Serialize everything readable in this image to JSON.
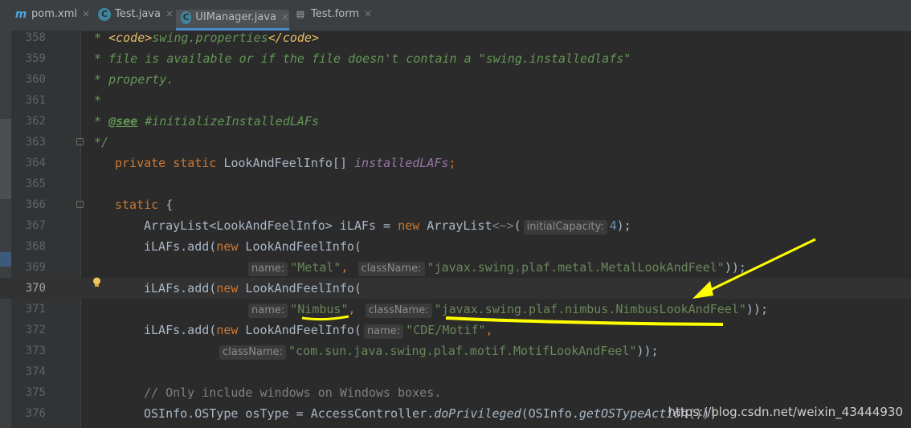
{
  "tabs": [
    {
      "icon_text": "m",
      "label": "pom.xml"
    },
    {
      "icon_text": "C",
      "label": "Test.java"
    },
    {
      "icon_text": "C",
      "label": "UIManager.java"
    },
    {
      "icon_text": "▤",
      "label": "Test.form"
    }
  ],
  "close_glyph": "×",
  "code_lines": {
    "358": {
      "num": "358",
      "star": " * ",
      "tag_open": "<code>",
      "text": "swing.properties",
      "tag_close": "</code>"
    },
    "359": {
      "num": "359",
      "text": " * file is available or if the file doesn't contain a \"swing.installedlafs\""
    },
    "360": {
      "num": "360",
      "text": " * property."
    },
    "361": {
      "num": "361",
      "text": " *"
    },
    "362": {
      "num": "362",
      "star": " * ",
      "ann": "@see",
      "text": " #initializeInstalledLAFs"
    },
    "363": {
      "num": "363",
      "text": " */"
    },
    "364": {
      "num": "364",
      "kw": "private static",
      "type": " LookAndFeelInfo[] ",
      "field": "installedLAFs",
      "end": ";"
    },
    "365": {
      "num": "365"
    },
    "366": {
      "num": "366",
      "kw": "static",
      "text": " {"
    },
    "367": {
      "num": "367",
      "a": "ArrayList<LookAndFeelInfo> iLAFs = ",
      "kw": "new",
      "b": " ArrayList",
      "diamond": "<~>",
      "c": "(",
      "hint": "initialCapacity:",
      "num_val": "4",
      "d": ");"
    },
    "368": {
      "num": "368",
      "a": "iLAFs.add(",
      "kw": "new",
      "b": " LookAndFeelInfo("
    },
    "369": {
      "num": "369",
      "hint1": "name:",
      "str1": "\"Metal\"",
      "comma": ",",
      "hint2": "className:",
      "str2": "\"javax.swing.plaf.metal.MetalLookAndFeel\"",
      "end": "));"
    },
    "370": {
      "num": "370",
      "a": "iLAFs.add(",
      "kw": "new",
      "b": " LookAndFeelInfo("
    },
    "371": {
      "num": "371",
      "hint1": "name:",
      "str1": "\"Nimbus\"",
      "comma": ",",
      "hint2": "className:",
      "str2": "\"javax.swing.plaf.nimbus.NimbusLookAndFeel\"",
      "end": "));"
    },
    "372": {
      "num": "372",
      "a": "iLAFs.add(",
      "kw": "new",
      "b": " LookAndFeelInfo(",
      "hint1": "name:",
      "str1": "\"CDE/Motif\"",
      "comma": ","
    },
    "373": {
      "num": "373",
      "hint2": "className:",
      "str2": "\"com.sun.java.swing.plaf.motif.MotifLookAndFeel\"",
      "end": "));"
    },
    "374": {
      "num": "374"
    },
    "375": {
      "num": "375",
      "text": "// Only include windows on Windows boxes."
    },
    "376": {
      "num": "376",
      "a": "OSInfo.OSType osType = AccessController.",
      "m1": "doPrivileged",
      "b": "(OSInfo.",
      "m2": "getOSTypeAction",
      "c": "());"
    }
  },
  "watermark": "https://blog.csdn.net/weixin_43444930",
  "colors": {
    "annotation": "#ffff00",
    "keyword": "#cc7832",
    "string": "#6a8759",
    "comment": "#629755"
  }
}
